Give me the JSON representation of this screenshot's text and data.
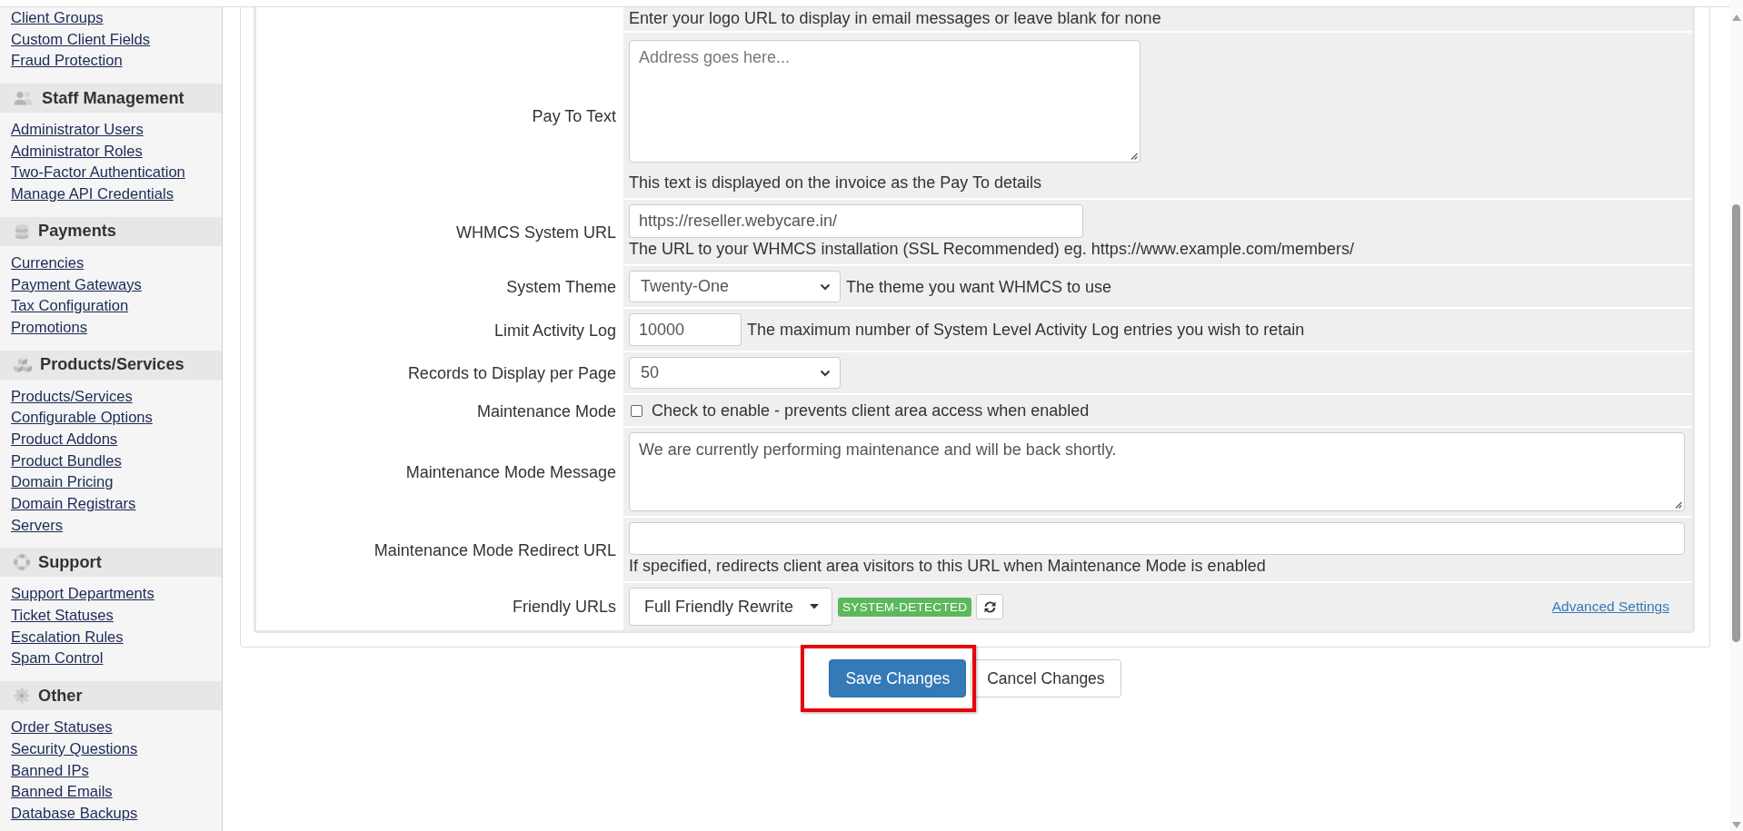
{
  "sidebar": {
    "sections": [
      {
        "links": [
          "Client Groups",
          "Custom Client Fields",
          "Fraud Protection"
        ]
      },
      {
        "heading": "Staff Management",
        "links": [
          "Administrator Users",
          "Administrator Roles",
          "Two-Factor Authentication",
          "Manage API Credentials"
        ]
      },
      {
        "heading": "Payments",
        "links": [
          "Currencies",
          "Payment Gateways",
          "Tax Configuration",
          "Promotions"
        ]
      },
      {
        "heading": "Products/Services",
        "links": [
          "Products/Services",
          "Configurable Options",
          "Product Addons",
          "Product Bundles",
          "Domain Pricing",
          "Domain Registrars",
          "Servers"
        ]
      },
      {
        "heading": "Support",
        "links": [
          "Support Departments",
          "Ticket Statuses",
          "Escalation Rules",
          "Spam Control"
        ]
      },
      {
        "heading": "Other",
        "links": [
          "Order Statuses",
          "Security Questions",
          "Banned IPs",
          "Banned Emails",
          "Database Backups"
        ]
      }
    ]
  },
  "settings": {
    "rows": [
      {
        "kind": "note",
        "description": "Enter your logo URL to display in email messages or leave blank for none"
      },
      {
        "kind": "textarea",
        "label": "Pay To Text",
        "placeholder": "Address goes here...",
        "description": "This text is displayed on the invoice as the Pay To details"
      },
      {
        "kind": "text",
        "label": "WHMCS System URL",
        "value": "https://reseller.webycare.in/",
        "description": "The URL to your WHMCS installation (SSL Recommended) eg. https://www.example.com/members/"
      },
      {
        "kind": "select",
        "label": "System Theme",
        "value": "Twenty-One",
        "inline_help": "The theme you want WHMCS to use"
      },
      {
        "kind": "text",
        "label": "Limit Activity Log",
        "value": "10000",
        "inline_help": "The maximum number of System Level Activity Log entries you wish to retain"
      },
      {
        "kind": "select",
        "label": "Records to Display per Page",
        "value": "50"
      },
      {
        "kind": "checkbox",
        "label": "Maintenance Mode",
        "checked": false,
        "checkbox_label": "Check to enable - prevents client area access when enabled"
      },
      {
        "kind": "textarea",
        "label": "Maintenance Mode Message",
        "value": "We are currently performing maintenance and will be back shortly."
      },
      {
        "kind": "text",
        "label": "Maintenance Mode Redirect URL",
        "description": "If specified, redirects client area visitors to this URL when Maintenance Mode is enabled"
      },
      {
        "kind": "dropdown",
        "label": "Friendly URLs",
        "value": "Full Friendly Rewrite",
        "badge": "SYSTEM-DETECTED",
        "link": "Advanced Settings"
      }
    ]
  },
  "actions": [
    {
      "kind": "primary",
      "label": "Save Changes",
      "highlighted": true
    },
    {
      "kind": "default",
      "label": "Cancel Changes",
      "highlighted": false
    }
  ]
}
